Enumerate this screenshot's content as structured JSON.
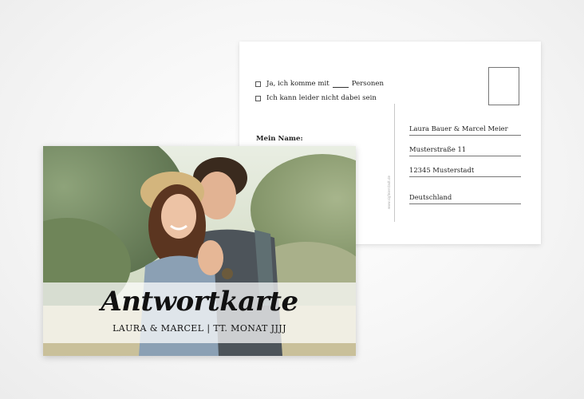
{
  "back_card": {
    "option_yes_prefix": "Ja, ich komme mit",
    "option_yes_suffix": "Personen",
    "option_no": "Ich kann leider nicht dabei sein",
    "name_label": "Mein Name:",
    "vertical_url": "www.sigfeierstadt.de",
    "address": {
      "line1": "Laura Bauer & Marcel Meier",
      "line2": "Musterstraße 11",
      "line3": "12345 Musterstadt",
      "line4": "Deutschland"
    }
  },
  "front_card": {
    "title": "Antwortkarte",
    "subtitle": "LAURA & MARCEL | TT. MONAT JJJJ"
  }
}
